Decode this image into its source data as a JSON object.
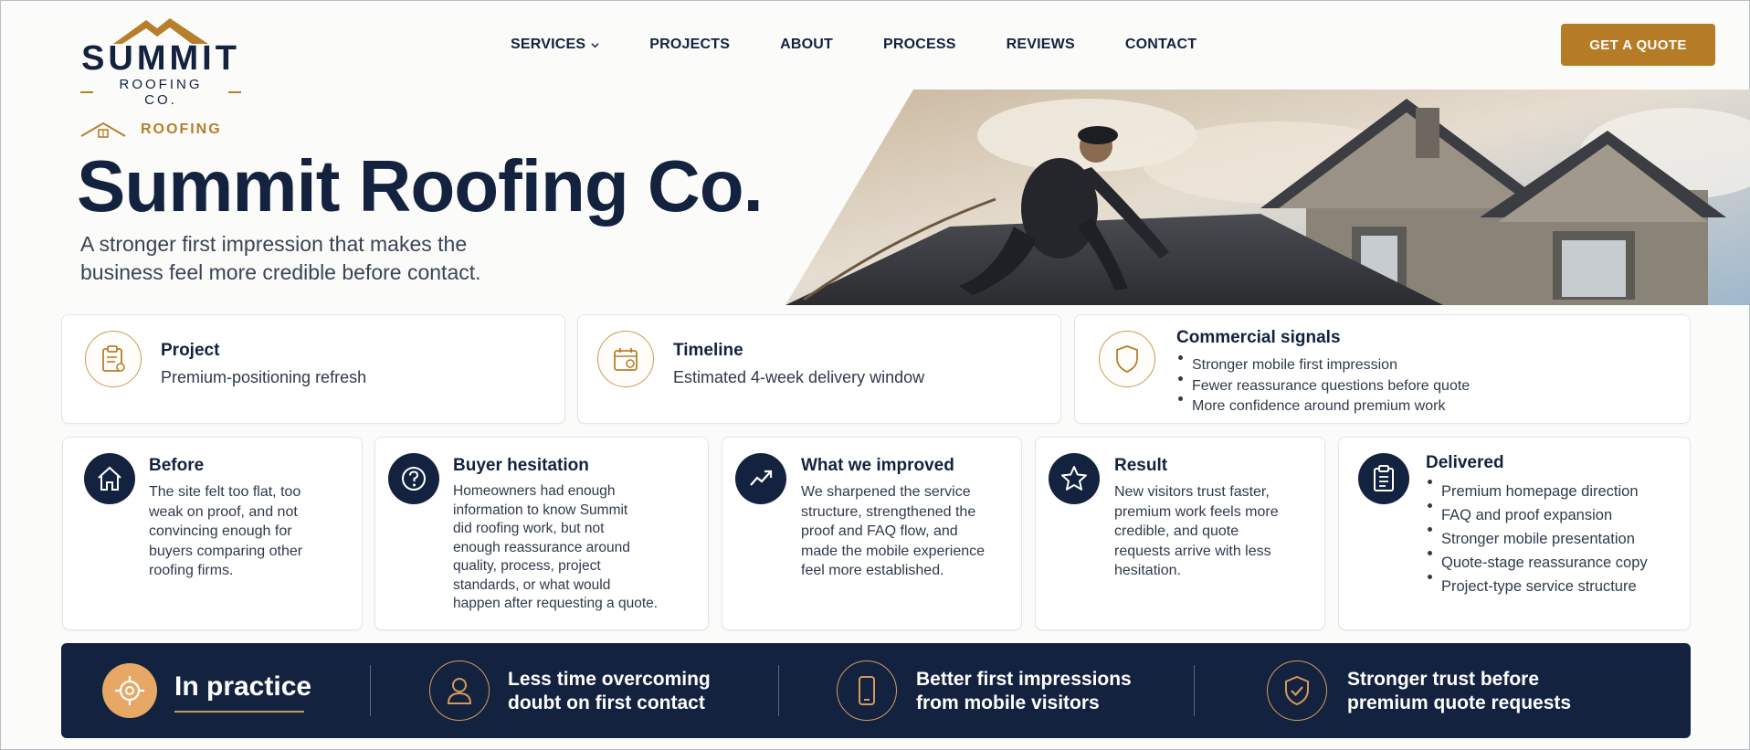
{
  "colors": {
    "navy": "#13223f",
    "gold": "#b67b26",
    "gold_light": "#e7a866",
    "background": "#fbfbfa"
  },
  "brand": {
    "logo_word": "SUMMIT",
    "logo_sub": "ROOFING CO.",
    "logo_icon": "mountain-icon"
  },
  "nav": {
    "items": [
      {
        "label": "SERVICES",
        "has_dropdown": true
      },
      {
        "label": "PROJECTS"
      },
      {
        "label": "ABOUT"
      },
      {
        "label": "PROCESS"
      },
      {
        "label": "REVIEWS"
      },
      {
        "label": "CONTACT"
      }
    ],
    "cta": "GET A QUOTE"
  },
  "hero": {
    "eyebrow": "ROOFING",
    "title": "Summit Roofing Co.",
    "subtitle_line1": "A stronger first impression that makes the",
    "subtitle_line2": "business feel more credible before contact.",
    "image": "roofer-on-roof-photo"
  },
  "info_cards": {
    "project": {
      "icon": "clipboard-icon",
      "title": "Project",
      "text": "Premium-positioning refresh"
    },
    "timeline": {
      "icon": "calendar-icon",
      "title": "Timeline",
      "text": "Estimated 4-week delivery window"
    },
    "signals": {
      "icon": "shield-icon",
      "title": "Commercial signals",
      "items": [
        "Stronger mobile first impression",
        "Fewer reassurance questions before quote",
        "More confidence around premium work"
      ]
    }
  },
  "features": {
    "before": {
      "icon": "house-icon",
      "title": "Before",
      "lines": [
        "The site felt too flat, too",
        "weak on proof, and not",
        "convincing enough for",
        "buyers comparing other",
        "roofing firms."
      ]
    },
    "hesitation": {
      "icon": "question-icon",
      "title": "Buyer hesitation",
      "lines": [
        "Homeowners had enough",
        "information to know Summit",
        "did roofing work, but not",
        "enough reassurance around",
        "quality, process, project",
        "standards, or what would",
        "happen after requesting a quote."
      ]
    },
    "improved": {
      "icon": "trend-up-icon",
      "title": "What we improved",
      "lines": [
        "We sharpened the service",
        "structure, strengthened the",
        "proof and FAQ flow, and",
        "made the mobile experience",
        "feel more established."
      ]
    },
    "result": {
      "icon": "star-icon",
      "title": "Result",
      "lines": [
        "New visitors trust faster,",
        "premium work feels more",
        "credible, and quote",
        "requests arrive with less",
        "hesitation."
      ]
    },
    "delivered": {
      "icon": "checklist-icon",
      "title": "Delivered",
      "items": [
        "Premium homepage direction",
        "FAQ and proof expansion",
        "Stronger mobile presentation",
        "Quote-stage reassurance copy",
        "Project-type service structure"
      ]
    }
  },
  "band": {
    "heading": "In practice",
    "heading_icon": "target-icon",
    "items": [
      {
        "icon": "user-icon",
        "line1": "Less time overcoming",
        "line2": "doubt on first contact"
      },
      {
        "icon": "mobile-icon",
        "line1": "Better first impressions",
        "line2": "from mobile visitors"
      },
      {
        "icon": "shield-check-icon",
        "line1": "Stronger trust before",
        "line2": "premium quote requests"
      }
    ]
  }
}
